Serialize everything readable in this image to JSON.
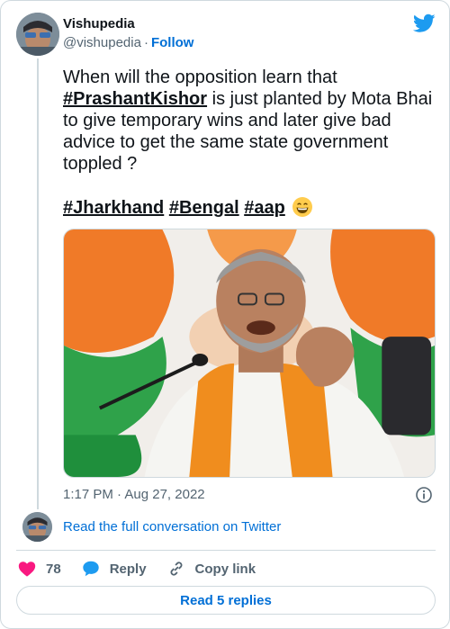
{
  "author": {
    "display_name": "Vishupedia",
    "handle": "@vishupedia",
    "separator": "·",
    "follow_label": "Follow"
  },
  "brand": {
    "icon": "twitter-bird-icon",
    "color": "#1d9bf0"
  },
  "tweet": {
    "text_intro": "When will the opposition learn that ",
    "hashtag_1": "#PrashantKishor",
    "text_rest": " is just planted by Mota Bhai to give temporary wins and later give bad advice to get the same state government toppled ?",
    "hashtag_2": "#Jharkhand",
    "hashtag_3": "#Bengal",
    "hashtag_4": "#aap",
    "emoji": "grinning-face-with-smiling-eyes"
  },
  "meta": {
    "time": "1:17 PM",
    "separator": "·",
    "date": "Aug 27, 2022",
    "info_icon": "info-icon"
  },
  "conversation_link": "Read the full conversation on Twitter",
  "actions": {
    "like_count": "78",
    "reply_label": "Reply",
    "copy_label": "Copy link"
  },
  "read_replies_label": "Read 5 replies",
  "colors": {
    "link": "#006fd6",
    "secondary_text": "#536471",
    "border": "#cfd9de",
    "like": "#f91880",
    "reply": "#1d9bf0"
  }
}
